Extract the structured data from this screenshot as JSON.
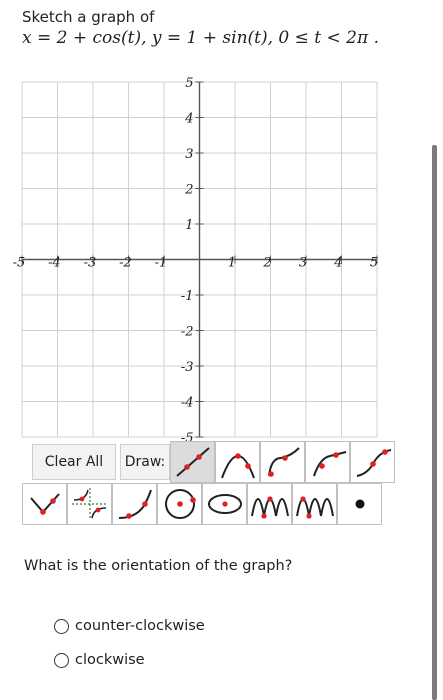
{
  "question": {
    "title": "Sketch a graph of",
    "equation": "x = 2 + cos(t), y = 1 + sin(t), 0 ≤ t < 2π ."
  },
  "graph": {
    "x_ticks": [
      "-5",
      "-4",
      "-3",
      "-2",
      "-1",
      "1",
      "2",
      "3",
      "4",
      "5"
    ],
    "y_ticks": [
      "5",
      "4",
      "3",
      "2",
      "1",
      "-1",
      "-2",
      "-3",
      "-4",
      "-5"
    ]
  },
  "toolbar": {
    "clear_label": "Clear All",
    "draw_label": "Draw:",
    "tools_row1": [
      "line-tool-icon",
      "parabola-tool-icon",
      "sqrt-tool-icon",
      "log-tool-icon",
      "cubic-tool-icon"
    ],
    "tools_row2": [
      "absolute-value-tool-icon",
      "rational-tool-icon",
      "exponential-tool-icon",
      "circle-tool-icon",
      "ellipse-tool-icon",
      "sine-tool-icon",
      "cosine-tool-icon",
      "point-tool-icon"
    ]
  },
  "question2": {
    "prompt": "What is the orientation of the graph?",
    "options": [
      "counter-clockwise",
      "clockwise"
    ]
  },
  "colors": {
    "grid": "#d0d0d0",
    "axis": "#555555",
    "tool_red": "#e02020",
    "selected_tool_bg": "#dcdcdc"
  }
}
